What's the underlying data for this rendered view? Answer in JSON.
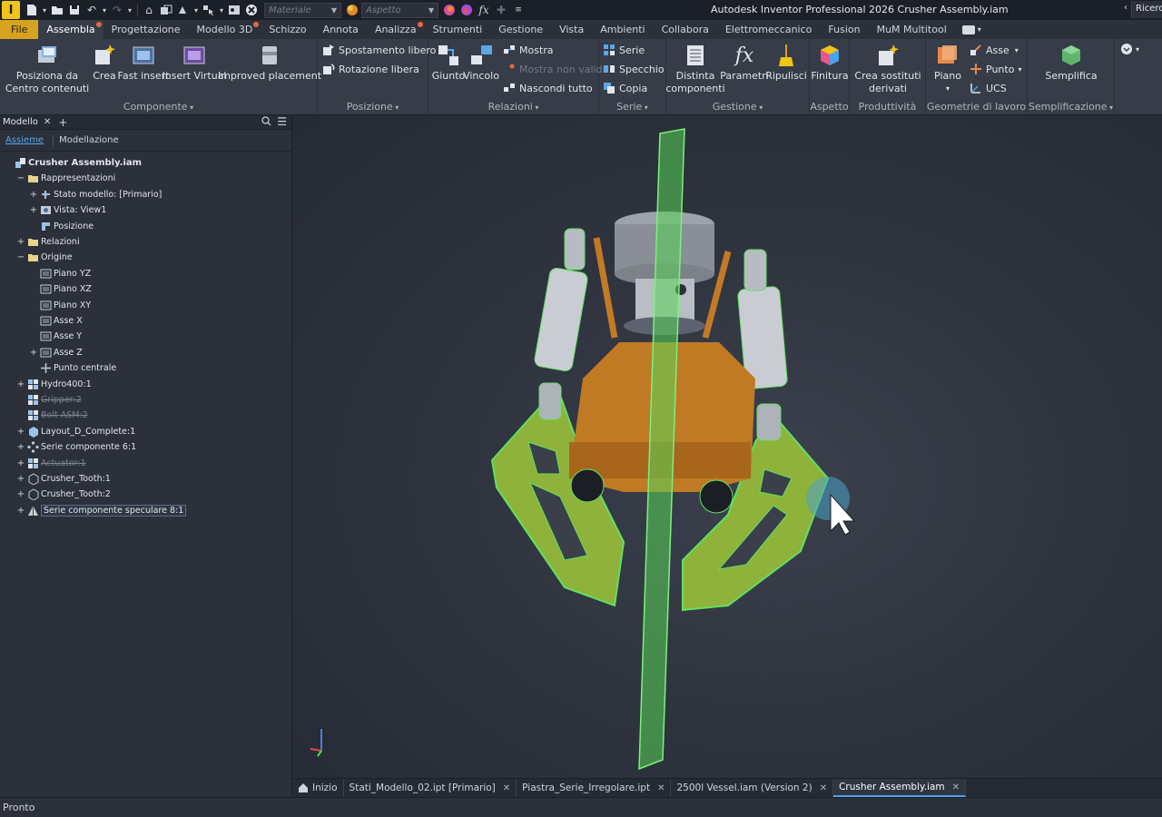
{
  "window": {
    "logo_letter": "I",
    "title": "Autodesk Inventor Professional 2026   Crusher Assembly.iam",
    "search_text": "Ricerca"
  },
  "qat": {
    "material_placeholder": "Materiale",
    "appearance_placeholder": "Aspetto"
  },
  "ribbon_tabs": [
    {
      "label": "File"
    },
    {
      "label": "Assembla",
      "active": true
    },
    {
      "label": "Progettazione"
    },
    {
      "label": "Modello 3D"
    },
    {
      "label": "Schizzo"
    },
    {
      "label": "Annota"
    },
    {
      "label": "Analizza"
    },
    {
      "label": "Strumenti"
    },
    {
      "label": "Gestione"
    },
    {
      "label": "Vista"
    },
    {
      "label": "Ambienti"
    },
    {
      "label": "Collabora"
    },
    {
      "label": "Elettromeccanico"
    },
    {
      "label": "Fusion"
    },
    {
      "label": "MuM Multitool"
    }
  ],
  "ribbon": {
    "componente": {
      "label": "Componente",
      "place_line1": "Posiziona da",
      "place_line2": "Centro contenuti",
      "create": "Crea",
      "fast_insert": "Fast insert",
      "insert_virtual": "Insert Virtual",
      "improved_placement": "Improved placement"
    },
    "posizione": {
      "label": "Posizione",
      "free_move": "Spostamento libero",
      "free_rotate": "Rotazione libera"
    },
    "relazioni": {
      "label": "Relazioni",
      "joint": "Giunto",
      "constraint": "Vincolo",
      "show": "Mostra",
      "show_invalid": "Mostra non validi",
      "hide_all": "Nascondi tutto"
    },
    "serie": {
      "label": "Serie",
      "pattern": "Serie",
      "mirror": "Specchio",
      "copy": "Copia"
    },
    "gestione": {
      "label": "Gestione",
      "bom_line1": "Distinta",
      "bom_line2": "componenti",
      "parameters": "Parametri",
      "clean": "Ripulisci"
    },
    "aspetto": {
      "label": "Aspetto",
      "finish": "Finitura"
    },
    "produttivita": {
      "label": "Produttività",
      "substitutes_line1": "Crea sostituti",
      "substitutes_line2": "derivati"
    },
    "geometrie": {
      "label": "Geometrie di lavoro",
      "plane": "Piano",
      "axis": "Asse",
      "point": "Punto",
      "ucs": "UCS"
    },
    "semplificazione": {
      "label": "Semplificazione",
      "simplify": "Semplifica"
    }
  },
  "browser": {
    "tab": "Modello",
    "subtab_assembly": "Assieme",
    "subtab_modeling": "Modellazione",
    "tree": [
      {
        "label": "Crusher Assembly.iam",
        "indent": 0,
        "toggle": "",
        "icon": "assembly",
        "bold": true
      },
      {
        "label": "Rappresentazioni",
        "indent": 1,
        "toggle": "−",
        "icon": "folder"
      },
      {
        "label": "Stato modello: [Primario]",
        "indent": 2,
        "toggle": "+",
        "icon": "model-state"
      },
      {
        "label": "Vista: View1",
        "indent": 2,
        "toggle": "+",
        "icon": "view"
      },
      {
        "label": "Posizione",
        "indent": 2,
        "toggle": "",
        "icon": "position"
      },
      {
        "label": "Relazioni",
        "indent": 1,
        "toggle": "+",
        "icon": "folder"
      },
      {
        "label": "Origine",
        "indent": 1,
        "toggle": "−",
        "icon": "folder"
      },
      {
        "label": "Piano YZ",
        "indent": 2,
        "toggle": "",
        "icon": "plane"
      },
      {
        "label": "Piano XZ",
        "indent": 2,
        "toggle": "",
        "icon": "plane"
      },
      {
        "label": "Piano XY",
        "indent": 2,
        "toggle": "",
        "icon": "plane"
      },
      {
        "label": "Asse X",
        "indent": 2,
        "toggle": "",
        "icon": "plane"
      },
      {
        "label": "Asse Y",
        "indent": 2,
        "toggle": "",
        "icon": "plane"
      },
      {
        "label": "Asse Z",
        "indent": 2,
        "toggle": "+",
        "icon": "plane"
      },
      {
        "label": "Punto centrale",
        "indent": 2,
        "toggle": "",
        "icon": "point"
      },
      {
        "label": "Hydro400:1",
        "indent": 1,
        "toggle": "+",
        "icon": "subassembly"
      },
      {
        "label": "Gripper:2",
        "indent": 1,
        "toggle": "",
        "icon": "subassembly",
        "suppressed": true
      },
      {
        "label": "Bolt ASM:2",
        "indent": 1,
        "toggle": "",
        "icon": "subassembly",
        "suppressed": true
      },
      {
        "label": "Layout_D_Complete:1",
        "indent": 1,
        "toggle": "+",
        "icon": "part"
      },
      {
        "label": "Serie componente 6:1",
        "indent": 1,
        "toggle": "+",
        "icon": "pattern"
      },
      {
        "label": "Actuator:1",
        "indent": 1,
        "toggle": "+",
        "icon": "subassembly",
        "suppressed": true
      },
      {
        "label": "Crusher_Tooth:1",
        "indent": 1,
        "toggle": "+",
        "icon": "part-outline"
      },
      {
        "label": "Crusher_Tooth:2",
        "indent": 1,
        "toggle": "+",
        "icon": "part-outline"
      },
      {
        "label": "Serie componente speculare 8:1",
        "indent": 1,
        "toggle": "+",
        "icon": "mirror",
        "selected": true
      }
    ]
  },
  "doc_tabs": [
    {
      "label": "Inizio",
      "home": true
    },
    {
      "label": "Stati_Modello_02.ipt [Primario]"
    },
    {
      "label": "Piastra_Serie_Irregolare.ipt"
    },
    {
      "label": "2500l Vessel.iam (Version 2)"
    },
    {
      "label": "Crusher Assembly.iam",
      "active": true
    }
  ],
  "status": {
    "text": "Pronto"
  },
  "colors": {
    "accent": "#d7a21e",
    "selection_green": "#57d657",
    "body_orange": "#c07a23",
    "active_tab_underline": "#4aa3e8"
  }
}
